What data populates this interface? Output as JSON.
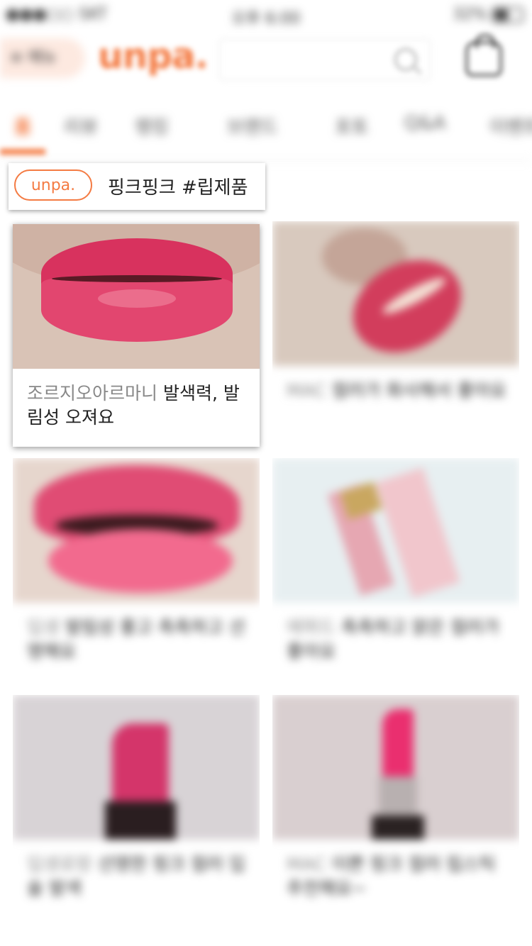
{
  "status_bar": {
    "carrier": "●●●○○ SKT",
    "time": "오후 6:00",
    "battery": "32%"
  },
  "header": {
    "menu_label": "≡ 메뉴",
    "logo": "unpa.",
    "search_placeholder": "",
    "icons": [
      "search-icon",
      "shopping-bag-icon"
    ]
  },
  "tabs": [
    {
      "label": "홈",
      "active": true
    },
    {
      "label": "리뷰",
      "active": false
    },
    {
      "label": "랭킹",
      "active": false
    },
    {
      "label": "브랜드",
      "active": false
    },
    {
      "label": "포토",
      "active": false
    },
    {
      "label": "Q&A",
      "active": false
    },
    {
      "label": "이벤트",
      "active": false
    }
  ],
  "tag_bar": {
    "brand": "unpa.",
    "text": "핑크핑크 #립제품"
  },
  "cards": [
    {
      "brand": "조르지오아르마니",
      "text": "발색력, 발림성 오져요",
      "blurred": false
    },
    {
      "brand": "MAC",
      "text": "컬러가 화사해서 좋아요",
      "blurred": true
    },
    {
      "brand": "입생",
      "text": "발림성 좋고 촉촉하고 선명해요",
      "blurred": true
    },
    {
      "brand": "에뛰드",
      "text": "촉촉하고 맑은 컬러가 좋아요",
      "blurred": true
    },
    {
      "brand": "입생로랑",
      "text": "선명한 핑크 컬러 입술 발색",
      "blurred": true
    },
    {
      "brand": "MAC",
      "text": "이쁜 핑크 컬러 립스틱 추천해요~",
      "blurred": true
    }
  ],
  "colors": {
    "accent": "#f47b43",
    "menu_bg": "#fde9e0"
  }
}
